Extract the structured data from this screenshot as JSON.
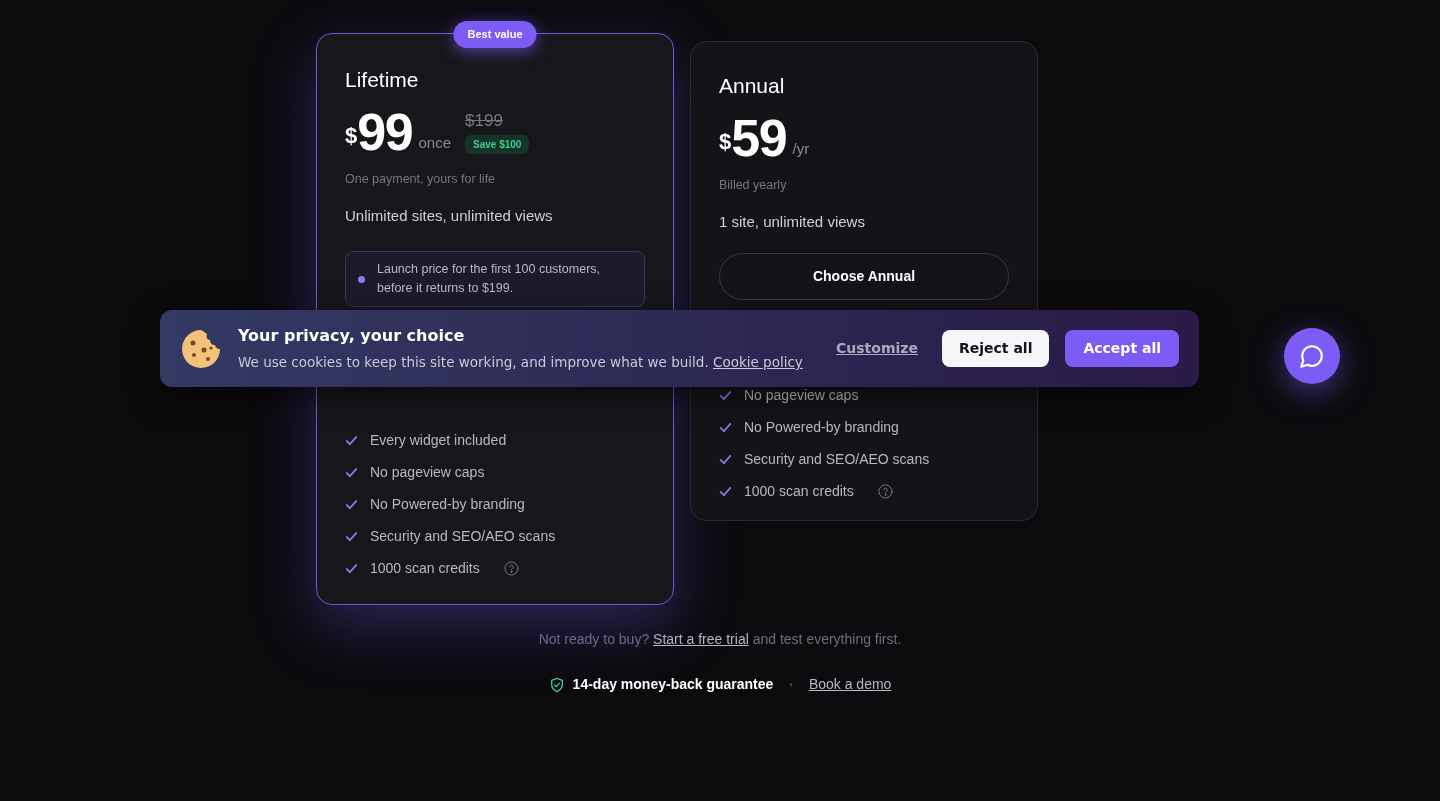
{
  "plans": [
    {
      "name": "Lifetime",
      "highlighted": true,
      "badge": "Best value",
      "currency": "$",
      "price": "99",
      "period": "once",
      "original_price": "$199",
      "savings": "Save $100",
      "subtitle": "One payment, yours for life",
      "headline": "Unlimited sites, unlimited views",
      "note": "Launch price for the first 100 customers, before it returns to $199.",
      "features": [
        {
          "text": "Every widget included",
          "help": false
        },
        {
          "text": "No pageview caps",
          "help": false
        },
        {
          "text": "No Powered-by branding",
          "help": false
        },
        {
          "text": "Security and SEO/AEO scans",
          "help": false
        },
        {
          "text": "1000 scan credits",
          "help": true
        }
      ]
    },
    {
      "name": "Annual",
      "highlighted": false,
      "currency": "$",
      "price": "59",
      "period": "/yr",
      "subtitle": "Billed yearly",
      "headline": "1 site, unlimited views",
      "button": "Choose Annual",
      "features": [
        {
          "text": "No pageview caps",
          "help": false
        },
        {
          "text": "No Powered-by branding",
          "help": false
        },
        {
          "text": "Security and SEO/AEO scans",
          "help": false
        },
        {
          "text": "1000 scan credits",
          "help": true
        }
      ]
    }
  ],
  "footer": {
    "before": "Not ready to buy?",
    "link": "Start a free trial",
    "after": "and test everything first.",
    "guarantee": "14-day money-back guarantee",
    "separator": "•",
    "demo": "Book a demo"
  },
  "cookie_banner": {
    "title": "Your privacy, your choice",
    "text": "We use cookies to keep this site working, and improve what we build.",
    "policy_link": "Cookie policy",
    "customize": "Customize",
    "reject": "Reject all",
    "accept": "Accept all"
  }
}
